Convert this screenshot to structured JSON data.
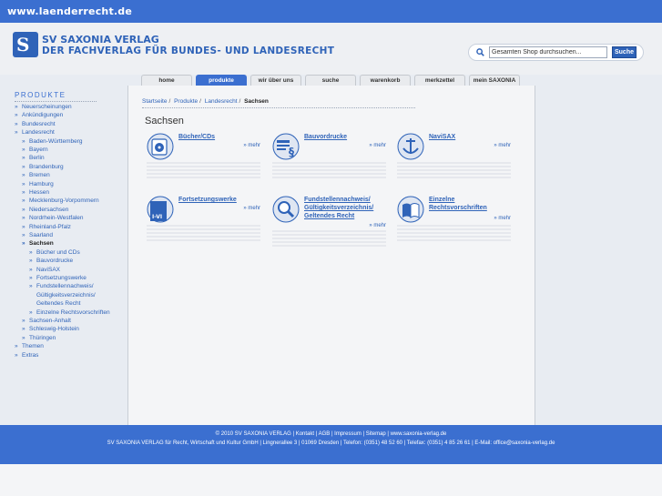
{
  "topbar": {
    "domain": "www.laenderrecht.de"
  },
  "logo": {
    "line1": "SV SAXONIA VERLAG",
    "line2": "DER FACHVERLAG FÜR BUNDES- UND LANDESRECHT",
    "mark": "S"
  },
  "search": {
    "value": "Gesamten Shop durchsuchen...",
    "button_label": "Suche"
  },
  "tabs": [
    {
      "label": "home",
      "active": false
    },
    {
      "label": "produkte",
      "active": true
    },
    {
      "label": "wir über uns",
      "active": false
    },
    {
      "label": "suche",
      "active": false
    },
    {
      "label": "warenkorb",
      "active": false
    },
    {
      "label": "merkzettel",
      "active": false
    },
    {
      "label": "mein SAXONIA",
      "active": false
    }
  ],
  "sidebar": {
    "heading": "PRODUKTE",
    "items": [
      {
        "label": "Neuerscheinungen",
        "level": 0
      },
      {
        "label": "Ankündigungen",
        "level": 0
      },
      {
        "label": "Bundesrecht",
        "level": 0
      },
      {
        "label": "Landesrecht",
        "level": 0
      },
      {
        "label": "Baden-Württemberg",
        "level": 1
      },
      {
        "label": "Bayern",
        "level": 1
      },
      {
        "label": "Berlin",
        "level": 1
      },
      {
        "label": "Brandenburg",
        "level": 1
      },
      {
        "label": "Bremen",
        "level": 1
      },
      {
        "label": "Hamburg",
        "level": 1
      },
      {
        "label": "Hessen",
        "level": 1
      },
      {
        "label": "Mecklenburg-Vorpommern",
        "level": 1
      },
      {
        "label": "Niedersachsen",
        "level": 1
      },
      {
        "label": "Nordrhein-Westfalen",
        "level": 1
      },
      {
        "label": "Rheinland-Pfalz",
        "level": 1
      },
      {
        "label": "Saarland",
        "level": 1
      },
      {
        "label": "Sachsen",
        "level": 1,
        "active": true
      },
      {
        "label": "Bücher und CDs",
        "level": 2
      },
      {
        "label": "Bauvordrucke",
        "level": 2
      },
      {
        "label": "NaviSAX",
        "level": 2
      },
      {
        "label": "Fortsetzungswerke",
        "level": 2
      },
      {
        "label": "Fundstellennachweis/",
        "level": 2
      },
      {
        "label": "Gültigkeitsverzeichnis/",
        "level": 2,
        "cont": true
      },
      {
        "label": "Geltendes Recht",
        "level": 2,
        "cont": true
      },
      {
        "label": "Einzelne Rechtsvorschriften",
        "level": 2
      },
      {
        "label": "Sachsen-Anhalt",
        "level": 1
      },
      {
        "label": "Schleswig-Holstein",
        "level": 1
      },
      {
        "label": "Thüringen",
        "level": 1
      },
      {
        "label": "Themen",
        "level": 0
      },
      {
        "label": "Extras",
        "level": 0
      }
    ]
  },
  "breadcrumb": {
    "items": [
      "Startseite",
      "Produkte",
      "Landesrecht"
    ],
    "current": "Sachsen"
  },
  "page_title": "Sachsen",
  "cards": [
    {
      "title": "Bücher/CDs",
      "more": "» mehr",
      "icon": "cd-icon"
    },
    {
      "title": "Bauvordrucke",
      "more": "» mehr",
      "icon": "forms-icon"
    },
    {
      "title": "NaviSAX",
      "more": "» mehr",
      "icon": "anchor-icon"
    },
    {
      "title": "Fortsetzungswerke",
      "more": "» mehr",
      "icon": "volumes-icon",
      "badge": "I-VI"
    },
    {
      "title": "Fundstellennachweis/ Gültigkeitsverzeichnis/ Geltendes Recht",
      "more": "» mehr",
      "icon": "magnifier-icon"
    },
    {
      "title": "Einzelne Rechtsvorschriften",
      "more": "» mehr",
      "icon": "book-icon"
    }
  ],
  "footer": {
    "line1": "© 2010 SV SAXONIA VERLAG  |  Kontakt  |  AGB  |  Impressum  |  Sitemap  |  www.saxonia-verlag.de",
    "line2": "SV SAXONIA VERLAG für Recht, Wirtschaft und Kultur GmbH  |  Lingnerallee 3  |  01069 Dresden  |  Telefon: (0351) 48 52 60  |  Telefax: (0351) 4 85 26 61  |  E-Mail: office@saxonia-verlag.de"
  },
  "colors": {
    "brand": "#3b6fd0",
    "link": "#2f63b8"
  }
}
